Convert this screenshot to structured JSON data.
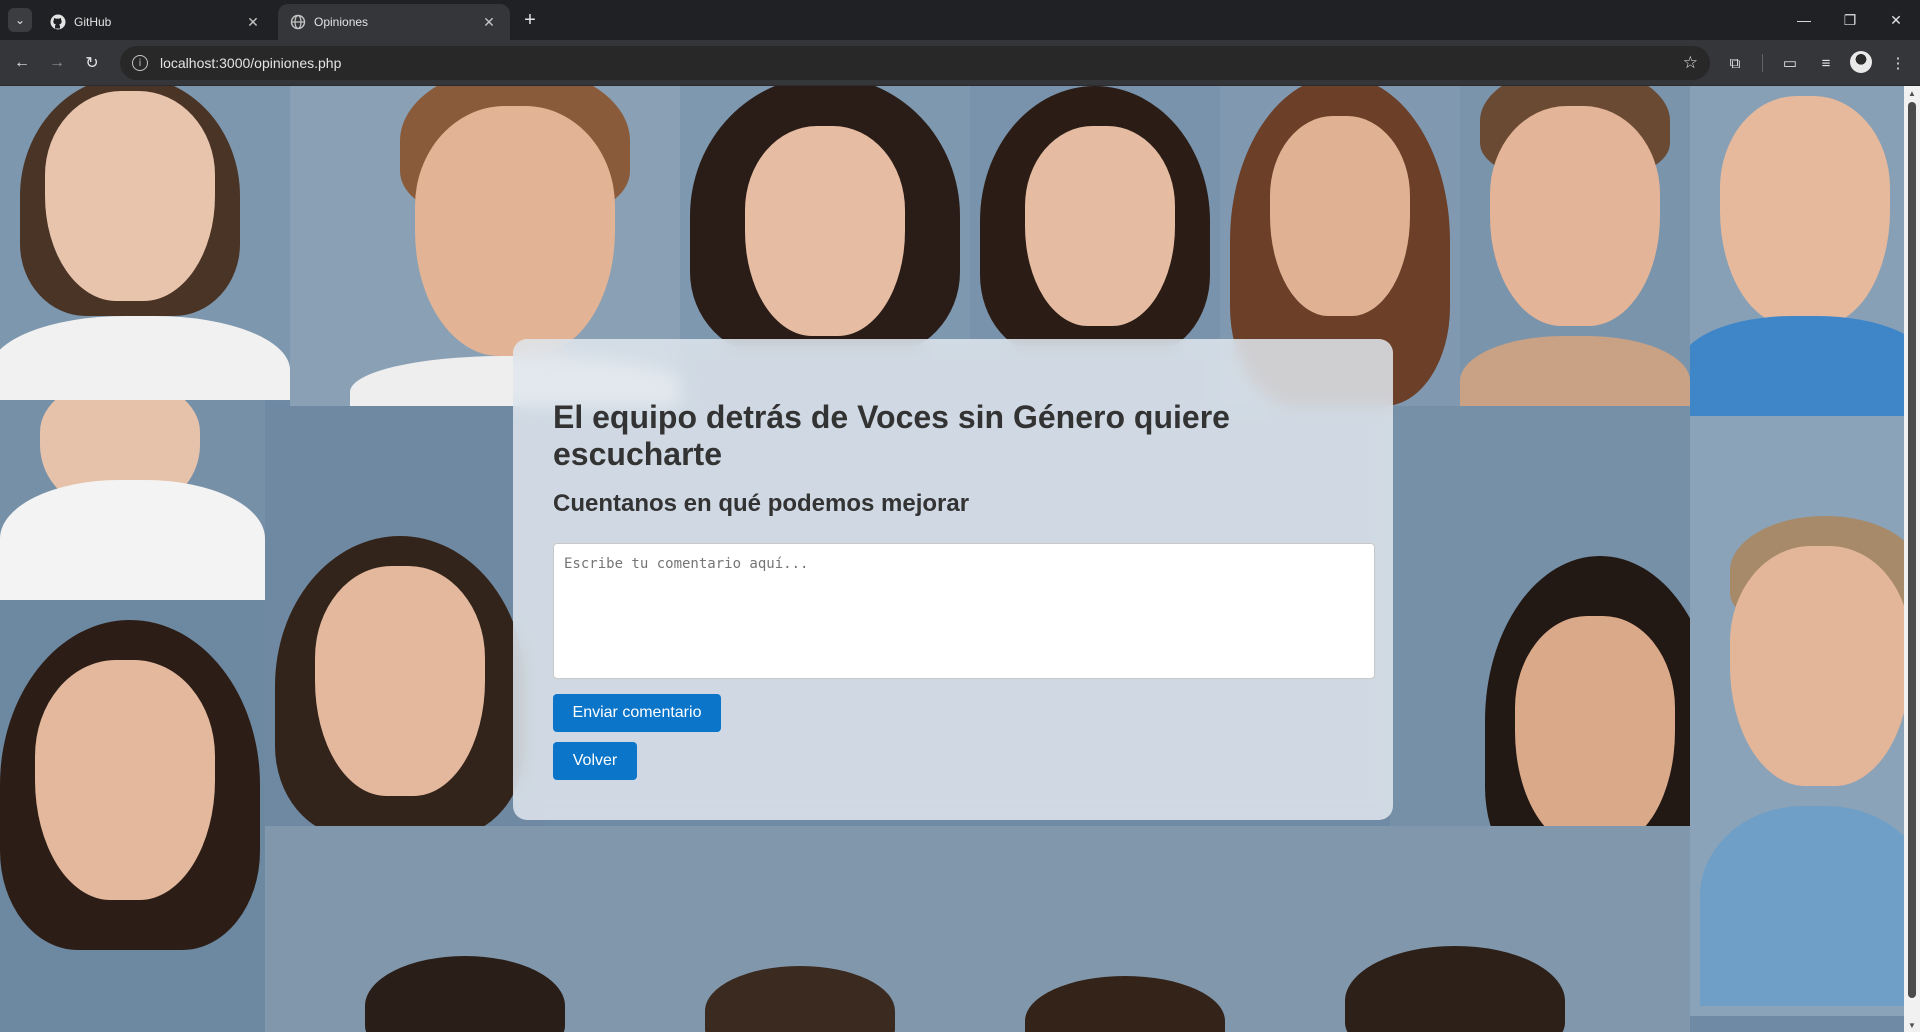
{
  "browser": {
    "tabs": [
      {
        "title": "GitHub",
        "icon": "github-icon",
        "active": false
      },
      {
        "title": "Opiniones",
        "icon": "globe-icon",
        "active": true
      }
    ],
    "url": "localhost:3000/opiniones.php"
  },
  "page": {
    "heading": "El equipo detrás de Voces sin Género quiere escucharte",
    "subheading": "Cuentanos en qué podemos mejorar",
    "comment": {
      "value": "",
      "placeholder": "Escribe tu comentario aquí..."
    },
    "send_label": "Enviar comentario",
    "back_label": "Volver"
  },
  "colors": {
    "button": "#0a75c9",
    "card": "#e0e6ee",
    "background": "#6f8aa4"
  }
}
